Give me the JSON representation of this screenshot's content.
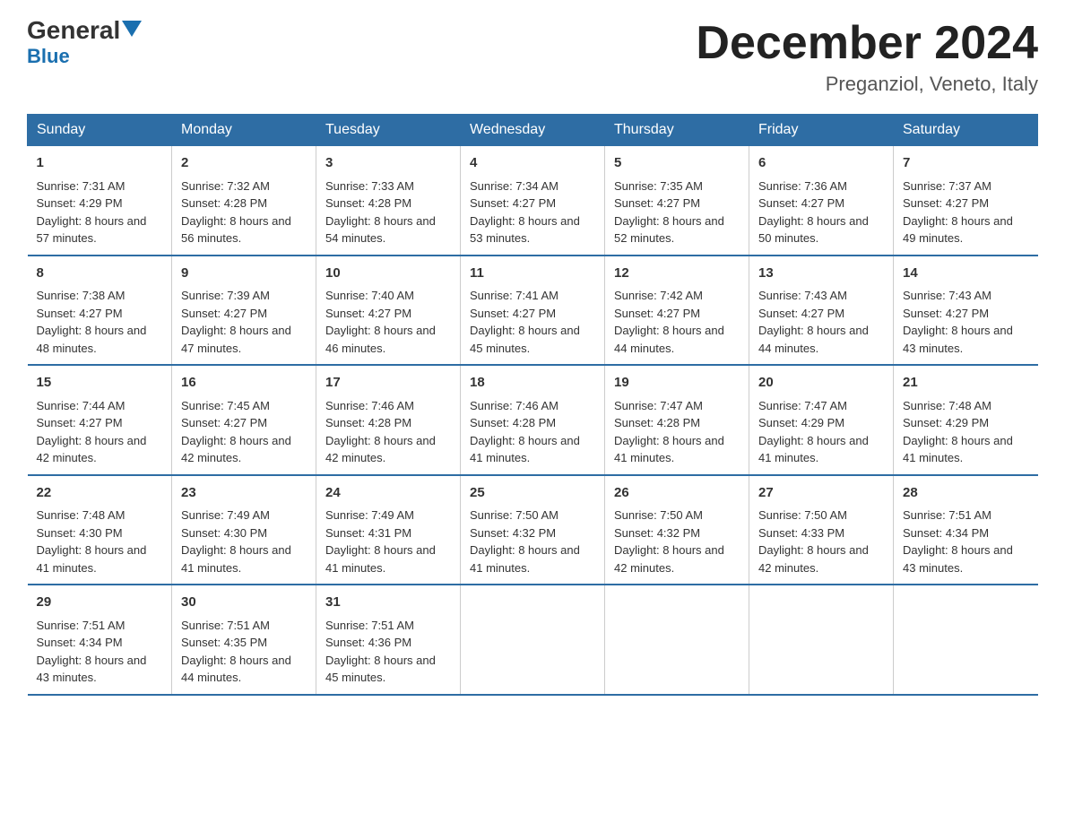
{
  "header": {
    "logo_general": "General",
    "logo_blue": "Blue",
    "month_title": "December 2024",
    "location": "Preganziol, Veneto, Italy"
  },
  "days_of_week": [
    "Sunday",
    "Monday",
    "Tuesday",
    "Wednesday",
    "Thursday",
    "Friday",
    "Saturday"
  ],
  "weeks": [
    [
      {
        "date": "1",
        "sunrise": "7:31 AM",
        "sunset": "4:29 PM",
        "daylight": "8 hours and 57 minutes."
      },
      {
        "date": "2",
        "sunrise": "7:32 AM",
        "sunset": "4:28 PM",
        "daylight": "8 hours and 56 minutes."
      },
      {
        "date": "3",
        "sunrise": "7:33 AM",
        "sunset": "4:28 PM",
        "daylight": "8 hours and 54 minutes."
      },
      {
        "date": "4",
        "sunrise": "7:34 AM",
        "sunset": "4:27 PM",
        "daylight": "8 hours and 53 minutes."
      },
      {
        "date": "5",
        "sunrise": "7:35 AM",
        "sunset": "4:27 PM",
        "daylight": "8 hours and 52 minutes."
      },
      {
        "date": "6",
        "sunrise": "7:36 AM",
        "sunset": "4:27 PM",
        "daylight": "8 hours and 50 minutes."
      },
      {
        "date": "7",
        "sunrise": "7:37 AM",
        "sunset": "4:27 PM",
        "daylight": "8 hours and 49 minutes."
      }
    ],
    [
      {
        "date": "8",
        "sunrise": "7:38 AM",
        "sunset": "4:27 PM",
        "daylight": "8 hours and 48 minutes."
      },
      {
        "date": "9",
        "sunrise": "7:39 AM",
        "sunset": "4:27 PM",
        "daylight": "8 hours and 47 minutes."
      },
      {
        "date": "10",
        "sunrise": "7:40 AM",
        "sunset": "4:27 PM",
        "daylight": "8 hours and 46 minutes."
      },
      {
        "date": "11",
        "sunrise": "7:41 AM",
        "sunset": "4:27 PM",
        "daylight": "8 hours and 45 minutes."
      },
      {
        "date": "12",
        "sunrise": "7:42 AM",
        "sunset": "4:27 PM",
        "daylight": "8 hours and 44 minutes."
      },
      {
        "date": "13",
        "sunrise": "7:43 AM",
        "sunset": "4:27 PM",
        "daylight": "8 hours and 44 minutes."
      },
      {
        "date": "14",
        "sunrise": "7:43 AM",
        "sunset": "4:27 PM",
        "daylight": "8 hours and 43 minutes."
      }
    ],
    [
      {
        "date": "15",
        "sunrise": "7:44 AM",
        "sunset": "4:27 PM",
        "daylight": "8 hours and 42 minutes."
      },
      {
        "date": "16",
        "sunrise": "7:45 AM",
        "sunset": "4:27 PM",
        "daylight": "8 hours and 42 minutes."
      },
      {
        "date": "17",
        "sunrise": "7:46 AM",
        "sunset": "4:28 PM",
        "daylight": "8 hours and 42 minutes."
      },
      {
        "date": "18",
        "sunrise": "7:46 AM",
        "sunset": "4:28 PM",
        "daylight": "8 hours and 41 minutes."
      },
      {
        "date": "19",
        "sunrise": "7:47 AM",
        "sunset": "4:28 PM",
        "daylight": "8 hours and 41 minutes."
      },
      {
        "date": "20",
        "sunrise": "7:47 AM",
        "sunset": "4:29 PM",
        "daylight": "8 hours and 41 minutes."
      },
      {
        "date": "21",
        "sunrise": "7:48 AM",
        "sunset": "4:29 PM",
        "daylight": "8 hours and 41 minutes."
      }
    ],
    [
      {
        "date": "22",
        "sunrise": "7:48 AM",
        "sunset": "4:30 PM",
        "daylight": "8 hours and 41 minutes."
      },
      {
        "date": "23",
        "sunrise": "7:49 AM",
        "sunset": "4:30 PM",
        "daylight": "8 hours and 41 minutes."
      },
      {
        "date": "24",
        "sunrise": "7:49 AM",
        "sunset": "4:31 PM",
        "daylight": "8 hours and 41 minutes."
      },
      {
        "date": "25",
        "sunrise": "7:50 AM",
        "sunset": "4:32 PM",
        "daylight": "8 hours and 41 minutes."
      },
      {
        "date": "26",
        "sunrise": "7:50 AM",
        "sunset": "4:32 PM",
        "daylight": "8 hours and 42 minutes."
      },
      {
        "date": "27",
        "sunrise": "7:50 AM",
        "sunset": "4:33 PM",
        "daylight": "8 hours and 42 minutes."
      },
      {
        "date": "28",
        "sunrise": "7:51 AM",
        "sunset": "4:34 PM",
        "daylight": "8 hours and 43 minutes."
      }
    ],
    [
      {
        "date": "29",
        "sunrise": "7:51 AM",
        "sunset": "4:34 PM",
        "daylight": "8 hours and 43 minutes."
      },
      {
        "date": "30",
        "sunrise": "7:51 AM",
        "sunset": "4:35 PM",
        "daylight": "8 hours and 44 minutes."
      },
      {
        "date": "31",
        "sunrise": "7:51 AM",
        "sunset": "4:36 PM",
        "daylight": "8 hours and 45 minutes."
      },
      null,
      null,
      null,
      null
    ]
  ]
}
